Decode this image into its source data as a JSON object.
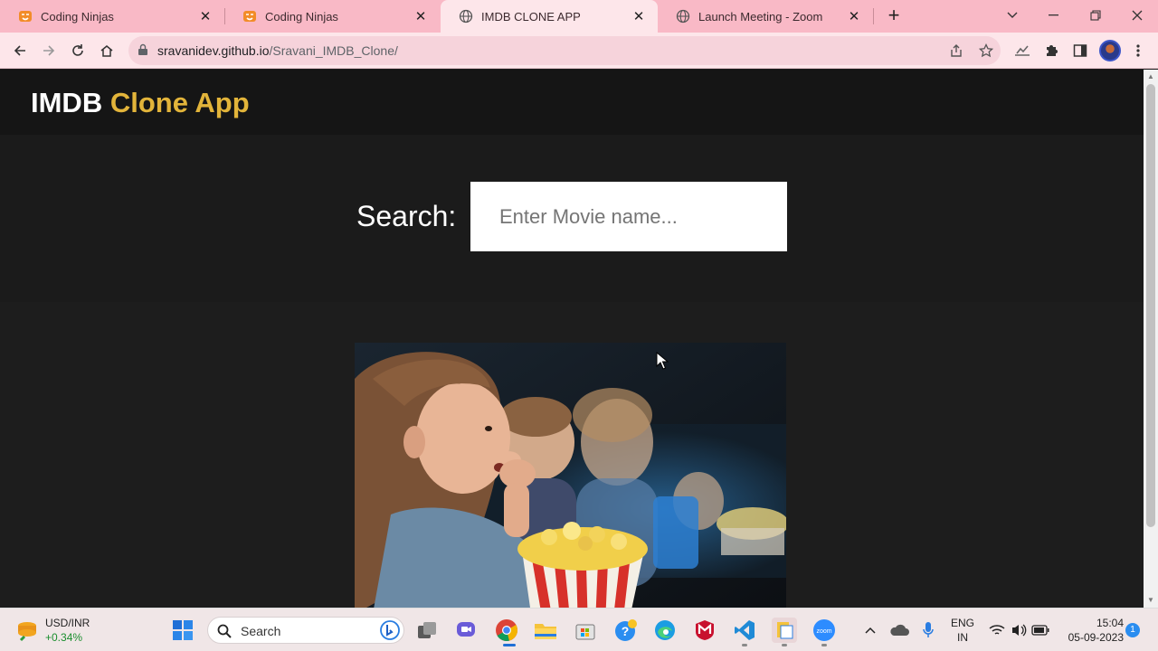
{
  "browser": {
    "tabs": [
      {
        "title": "Coding Ninjas",
        "active": false
      },
      {
        "title": "Coding Ninjas",
        "active": false
      },
      {
        "title": "IMDB CLONE APP",
        "active": true
      },
      {
        "title": "Launch Meeting - Zoom",
        "active": false
      }
    ],
    "url_domain": "sravanidev.github.io",
    "url_path": "/Sravani_IMDB_Clone/"
  },
  "page": {
    "brand_main": "IMDB",
    "brand_accent": "Clone App",
    "search_label": "Search:",
    "search_placeholder": "Enter Movie name...",
    "search_value": ""
  },
  "taskbar": {
    "widget_title": "USD/INR",
    "widget_change": "+0.34%",
    "search_label": "Search",
    "lang_line1": "ENG",
    "lang_line2": "IN",
    "time": "15:04",
    "date": "05-09-2023",
    "notifications": "1"
  },
  "colors": {
    "tabstrip": "#f9b9c6",
    "toolbar": "#fde6ea",
    "page_bg": "#1d1d1d",
    "navbar_bg": "#151515",
    "brand_accent": "#e2b43a"
  }
}
